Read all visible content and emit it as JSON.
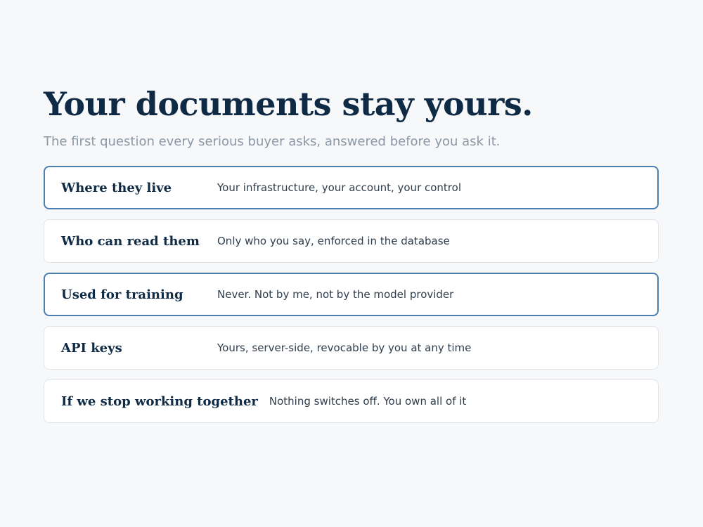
{
  "header": {
    "title": "Your documents stay yours.",
    "subtitle": "The first question every serious buyer asks, answered before you ask it."
  },
  "rows": [
    {
      "label": "Where they live",
      "value": "Your infrastructure, your account, your control",
      "highlighted": true
    },
    {
      "label": "Who can read them",
      "value": "Only who you say, enforced in the database",
      "highlighted": false
    },
    {
      "label": "Used for training",
      "value": "Never. Not by me, not by the model provider",
      "highlighted": true
    },
    {
      "label": "API keys",
      "value": "Yours, server-side, revocable by you at any time",
      "highlighted": false
    },
    {
      "label": "If we stop working together",
      "value": "Nothing switches off. You own all of it",
      "highlighted": false
    }
  ],
  "colors": {
    "background": "#f7f8fa",
    "title": "#0f2a45",
    "subtitle": "#8a97a6",
    "highlight_border": "#4c7fb0",
    "row_border": "#e1e5ea"
  }
}
